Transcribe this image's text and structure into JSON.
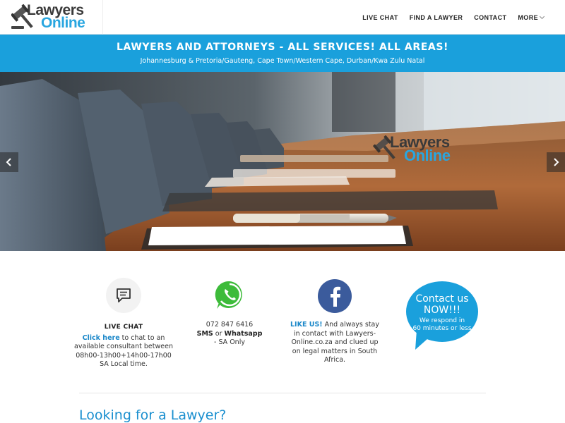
{
  "header": {
    "logo": {
      "line1": "Lawyers",
      "line2": "Online"
    },
    "nav": [
      {
        "label": "LIVE CHAT"
      },
      {
        "label": "FIND A LAWYER"
      },
      {
        "label": "CONTACT"
      },
      {
        "label": "MORE"
      }
    ]
  },
  "banner": {
    "title": "LAWYERS AND ATTORNEYS - ALL SERVICES! ALL AREAS!",
    "subtitle": "Johannesburg & Pretoria/Gauteng, Cape Town/Western Cape, Durban/Kwa Zulu Natal"
  },
  "hero": {
    "logo": {
      "line1": "Lawyers",
      "line2": "Online"
    },
    "prev_icon": "chevron-left-icon",
    "next_icon": "chevron-right-icon"
  },
  "features": {
    "chat": {
      "icon": "chat-icon",
      "title": "LIVE CHAT",
      "link": "Click here",
      "text1": " to chat to an available consultant between",
      "hours": "08h00-13h00+14h00-17h00",
      "text2": "SA Local time."
    },
    "phone": {
      "icon": "whatsapp-icon",
      "number": "072 847 6416",
      "sms": "SMS",
      "or": " or ",
      "whatsapp": "Whatsapp",
      "note": "- SA Only"
    },
    "facebook": {
      "icon": "facebook-icon",
      "link": "LIKE US!",
      "text": " And always stay in contact with Lawyers-Online.co.za and clued up on legal matters in South Africa."
    },
    "contact_bubble": {
      "line1": "Contact us",
      "line2": "NOW!!!",
      "line3": "We respond in",
      "line4": "60 minutes or less"
    }
  },
  "section": {
    "heading": "Looking for a Lawyer?"
  },
  "colors": {
    "accent": "#1aa0dc",
    "link": "#1a87c9",
    "whatsapp": "#3dbb3a",
    "facebook": "#3b5b9c"
  }
}
